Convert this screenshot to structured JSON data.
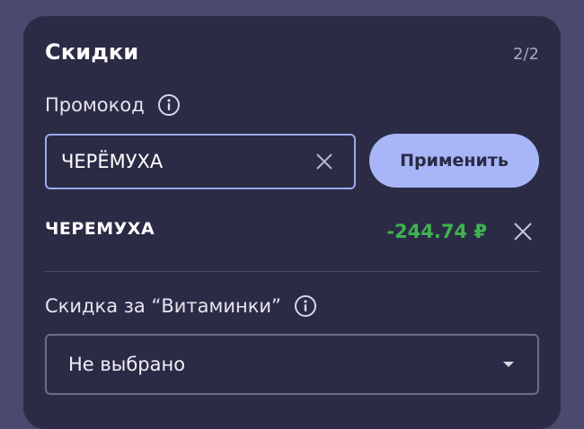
{
  "card": {
    "title": "Скидки",
    "step": "2/2"
  },
  "promo": {
    "label": "Промокод",
    "input_value": "ЧЕРЁМУХА",
    "apply_label": "Применить",
    "applied_code": "ЧЕРЕМУХА",
    "applied_discount": "-244.74 ₽",
    "discount_color": "#3fb34f"
  },
  "vitamins": {
    "label": "Скидка за “Витаминки”",
    "selected": "Не выбрано"
  },
  "icons": {
    "info": "info-icon",
    "clear": "close-icon",
    "remove": "close-icon",
    "dropdown": "chevron-down-icon"
  },
  "colors": {
    "accent": "#a8b5f7",
    "card_bg": "#2c2b46",
    "page_bg": "#4a4a6e"
  }
}
